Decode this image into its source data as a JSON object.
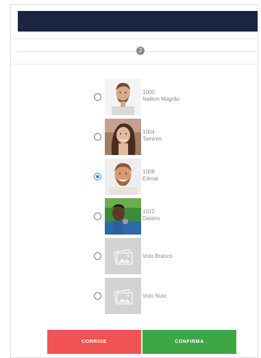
{
  "step": {
    "number": "2"
  },
  "candidates": [
    {
      "number": "1000",
      "name": "Nailton Magrão",
      "selected": false,
      "photo": "man-beard"
    },
    {
      "number": "1004",
      "name": "Tamires",
      "selected": false,
      "photo": "woman-dark-hair"
    },
    {
      "number": "1008",
      "name": "Edmar",
      "selected": true,
      "photo": "man-smiling"
    },
    {
      "number": "1012",
      "name": "Daiano",
      "selected": false,
      "photo": "man-outdoors"
    },
    {
      "number": "",
      "name": "Voto Branco",
      "selected": false,
      "photo": "image-placeholder-icon"
    },
    {
      "number": "",
      "name": "Voto Nulo",
      "selected": false,
      "photo": "image-placeholder-icon"
    }
  ],
  "buttons": {
    "corrige": "CORRIGE",
    "confirma": "CONFIRMA"
  },
  "colors": {
    "header": "#1b2540",
    "corrige": "#f15252",
    "confirma": "#3ea645",
    "radio_selected": "#3b8be0"
  }
}
